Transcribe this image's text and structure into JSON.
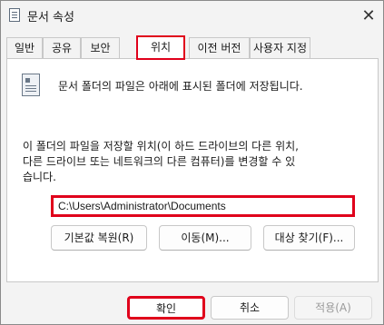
{
  "window": {
    "title": "문서 속성",
    "close_glyph": "✕"
  },
  "tabs": [
    {
      "label": "일반",
      "active": false
    },
    {
      "label": "공유",
      "active": false
    },
    {
      "label": "보안",
      "active": false
    },
    {
      "label": "위치",
      "active": true
    },
    {
      "label": "이전 버전",
      "active": false
    },
    {
      "label": "사용자 지정",
      "active": false
    }
  ],
  "location_tab": {
    "icon": "document-folder-icon",
    "description": "문서 폴더의 파일은 아래에 표시된 폴더에 저장됩니다.",
    "instructions_line1": "이 폴더의 파일을 저장할 위치(이 하드 드라이브의 다른 위치,",
    "instructions_line2": "다른 드라이브 또는 네트워크의 다른 컴퓨터)를 변경할 수 있",
    "instructions_line3": "습니다.",
    "path_value": "C:\\Users\\Administrator\\Documents",
    "restore_default_label": "기본값 복원(R)",
    "move_label": "이동(M)...",
    "find_target_label": "대상 찾기(F)..."
  },
  "footer": {
    "ok_label": "확인",
    "cancel_label": "취소",
    "apply_label": "적용(A)",
    "apply_enabled": false
  },
  "colors": {
    "highlight": "#e0001b",
    "window_bg": "#f3f3f3",
    "panel_bg": "#ffffff"
  }
}
